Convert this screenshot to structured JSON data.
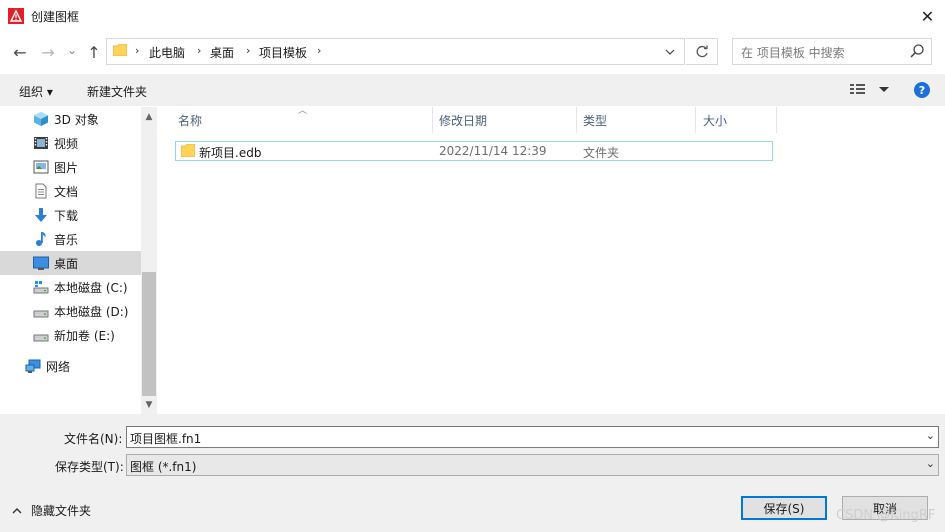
{
  "window": {
    "title": "创建图框",
    "close_glyph": "✕"
  },
  "nav": {
    "back_glyph": "←",
    "forward_glyph": "→",
    "recent_glyph": "⌄",
    "up_glyph": "↑"
  },
  "address": {
    "crumbs": [
      "此电脑",
      "桌面",
      "项目模板"
    ],
    "separator": "›"
  },
  "search": {
    "placeholder": "在 项目模板 中搜索"
  },
  "toolbar": {
    "organize_label": "组织 ▾",
    "new_folder_label": "新建文件夹"
  },
  "sidebar": {
    "items": [
      {
        "label": "3D 对象",
        "icon": "3d-objects-icon"
      },
      {
        "label": "视频",
        "icon": "video-icon"
      },
      {
        "label": "图片",
        "icon": "pictures-icon"
      },
      {
        "label": "文档",
        "icon": "documents-icon"
      },
      {
        "label": "下载",
        "icon": "download-icon"
      },
      {
        "label": "音乐",
        "icon": "music-icon"
      },
      {
        "label": "桌面",
        "icon": "desktop-icon",
        "selected": true
      },
      {
        "label": "本地磁盘 (C:)",
        "icon": "drive-c-icon"
      },
      {
        "label": "本地磁盘 (D:)",
        "icon": "drive-icon"
      },
      {
        "label": "新加卷 (E:)",
        "icon": "drive-icon"
      },
      {
        "label": "网络",
        "icon": "network-icon"
      }
    ]
  },
  "columns": [
    "名称",
    "修改日期",
    "类型",
    "大小"
  ],
  "files": [
    {
      "name": "新项目.edb",
      "modified": "2022/11/14 12:39",
      "type": "文件夹",
      "size": ""
    }
  ],
  "form": {
    "filename_label": "文件名(N):",
    "filename_value": "项目图框.fn1",
    "filetype_label": "保存类型(T):",
    "filetype_value": "图框 (*.fn1)"
  },
  "footer": {
    "hide_folders_label": "隐藏文件夹",
    "save_label": "保存(S)",
    "cancel_label": "取消",
    "watermark": "CSDN @KingRF"
  },
  "colors": {
    "accent": "#0078d7",
    "help": "#1e6fd9",
    "folder": "#ffd35a",
    "selection": "#d9d9d9"
  }
}
